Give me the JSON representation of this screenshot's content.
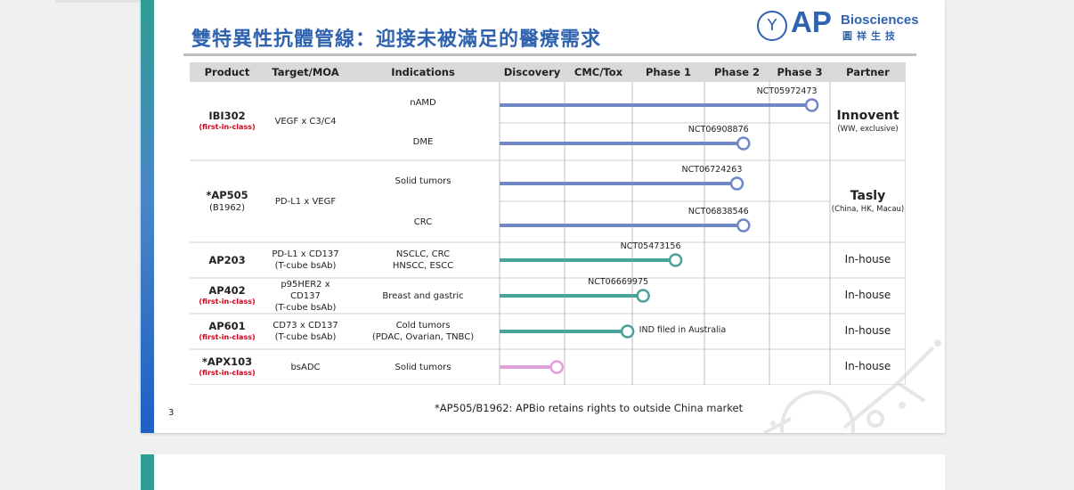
{
  "slide": {
    "title": "雙特異性抗體管線：迎接未被滿足的醫療需求",
    "page_number": "3",
    "footnote": "*AP505/B1962: APBio retains rights to outside China market",
    "logo": {
      "mark": "AP",
      "name": "Biosciences",
      "cn": "圓祥生技"
    }
  },
  "table": {
    "headers": [
      "Product",
      "Target/MOA",
      "Indications",
      "Discovery",
      "CMC/Tox",
      "Phase 1",
      "Phase 2",
      "Phase 3",
      "Partner"
    ],
    "programs": [
      {
        "product": "IBI302",
        "tag": "(first-in-class)",
        "target": "VEGF x C3/C4",
        "target2": "",
        "partner": "Innovent",
        "partner_sub": "(WW, exclusive)",
        "indications": [
          {
            "label": "nAMD",
            "label2": "",
            "nct": "NCT05972473",
            "stage_end": 4.7,
            "color": "#7088c8"
          },
          {
            "label": "DME",
            "label2": "",
            "nct": "NCT06908876",
            "stage_end": 3.6,
            "color": "#7088c8"
          }
        ]
      },
      {
        "product": "*AP505",
        "sub": "(B1962)",
        "target": "PD-L1 x VEGF",
        "target2": "",
        "partner": "Tasly",
        "partner_sub": "(China, HK, Macau)",
        "indications": [
          {
            "label": "Solid tumors",
            "label2": "",
            "nct": "NCT06724263",
            "stage_end": 3.5,
            "color": "#7088c8"
          },
          {
            "label": "CRC",
            "label2": "",
            "nct": "NCT06838546",
            "stage_end": 3.6,
            "color": "#7088c8"
          }
        ]
      },
      {
        "product": "AP203",
        "target": "PD-L1 x CD137",
        "target2": "(T-cube bsAb)",
        "partner": "In-house",
        "indications": [
          {
            "label": "NSCLC, CRC",
            "label2": "HNSCC, ESCC",
            "nct": "NCT05473156",
            "stage_end": 2.6,
            "color": "#4aa39a"
          }
        ]
      },
      {
        "product": "AP402",
        "tag": "(first-in-class)",
        "target": "p95HER2 x CD137",
        "target2": "(T-cube bsAb)",
        "partner": "In-house",
        "indications": [
          {
            "label": "Breast and gastric",
            "label2": "",
            "nct": "NCT06669975",
            "stage_end": 2.15,
            "color": "#4aa39a"
          }
        ]
      },
      {
        "product": "AP601",
        "tag": "(first-in-class)",
        "target": "CD73 x CD137",
        "target2": "(T-cube bsAb)",
        "partner": "In-house",
        "indications": [
          {
            "label": "Cold tumors",
            "label2": "(PDAC, Ovarian, TNBC)",
            "note": "IND filed in Australia",
            "stage_end": 1.93,
            "color": "#4aa39a"
          }
        ]
      },
      {
        "product": "*APX103",
        "tag": "(first-in-class)",
        "target": "bsADC",
        "target2": "",
        "partner": "In-house",
        "indications": [
          {
            "label": "Solid tumors",
            "label2": "",
            "stage_end": 0.88,
            "color": "#e0a0dc"
          }
        ]
      }
    ]
  }
}
